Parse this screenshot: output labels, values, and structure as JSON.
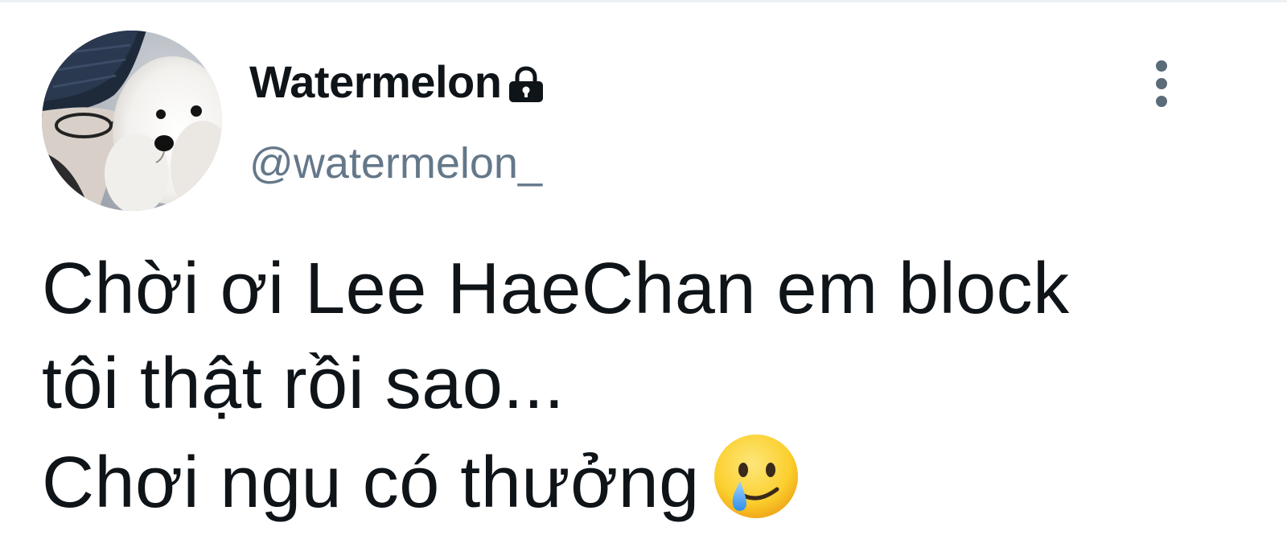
{
  "tweet": {
    "author": {
      "display_name": "Watermelon",
      "handle": "@watermelon_",
      "protected_icon": "lock-icon",
      "avatar": "avatar-person-with-white-poodle"
    },
    "menu_icon": "more-vertical-icon",
    "text_lines": [
      "Chời ơi Lee HaeChan em block",
      "tôi thật rồi sao...",
      "Chơi ngu có thưởng"
    ],
    "emoji": "smiling-face-with-tear"
  },
  "colors": {
    "text": "#0f1419",
    "handle": "#64788a",
    "icon_gray": "#5b6b78",
    "background": "#ffffff"
  }
}
